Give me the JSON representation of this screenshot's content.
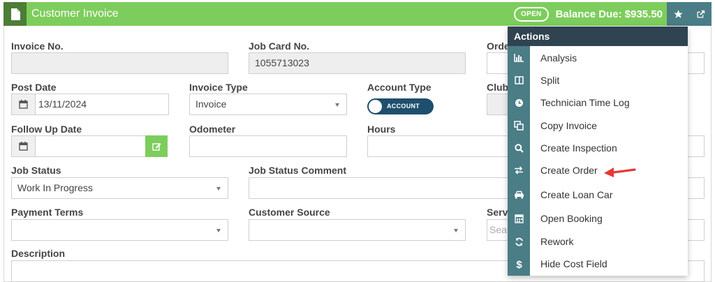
{
  "header": {
    "title": "Customer Invoice",
    "status": "OPEN",
    "balance": "Balance Due: $935.50",
    "icons": {
      "document": "document-icon",
      "favorite": "star-icon",
      "popout": "external-link-icon"
    }
  },
  "form": {
    "invoice_no": {
      "label": "Invoice No.",
      "value": ""
    },
    "job_card_no": {
      "label": "Job Card No.",
      "value": "1055713023"
    },
    "order_label": "Orde",
    "post_date": {
      "label": "Post Date",
      "value": "13/11/2024"
    },
    "invoice_type": {
      "label": "Invoice Type",
      "value": "Invoice"
    },
    "account_type": {
      "label": "Account Type",
      "value": "ACCOUNT"
    },
    "club_label": "Club",
    "follow_up_date": {
      "label": "Follow Up Date",
      "value": ""
    },
    "odometer": {
      "label": "Odometer",
      "value": ""
    },
    "hours": {
      "label": "Hours",
      "value": ""
    },
    "job_status": {
      "label": "Job Status",
      "value": "Work In Progress"
    },
    "job_status_comment": {
      "label": "Job Status Comment",
      "value": ""
    },
    "payment_terms": {
      "label": "Payment Terms",
      "value": ""
    },
    "customer_source": {
      "label": "Customer Source",
      "value": ""
    },
    "serv_label": "Serv",
    "serv_placeholder": "Sear",
    "description": {
      "label": "Description",
      "value": ""
    }
  },
  "actions_menu": {
    "title": "Actions",
    "items": [
      {
        "label": "Analysis",
        "icon": "bar-chart-icon"
      },
      {
        "label": "Split",
        "icon": "columns-icon"
      },
      {
        "label": "Technician Time Log",
        "icon": "clock-icon"
      },
      {
        "label": "Copy Invoice",
        "icon": "copy-icon"
      },
      {
        "label": "Create Inspection",
        "icon": "search-icon"
      },
      {
        "label": "Create Order",
        "icon": "exchange-icon"
      },
      {
        "label": "Create Loan Car",
        "icon": "car-icon"
      },
      {
        "label": "Open Booking",
        "icon": "calendar-icon"
      },
      {
        "label": "Rework",
        "icon": "refresh-icon"
      },
      {
        "label": "Hide Cost Field",
        "icon": "dollar-icon"
      }
    ]
  },
  "colors": {
    "header_green": "#7dcd5c",
    "header_dark": "#4d7d37",
    "menu_head": "#2f4350",
    "menu_rail": "#4a7d86",
    "toggle": "#1f4f6e",
    "arrow": "#e53935"
  }
}
